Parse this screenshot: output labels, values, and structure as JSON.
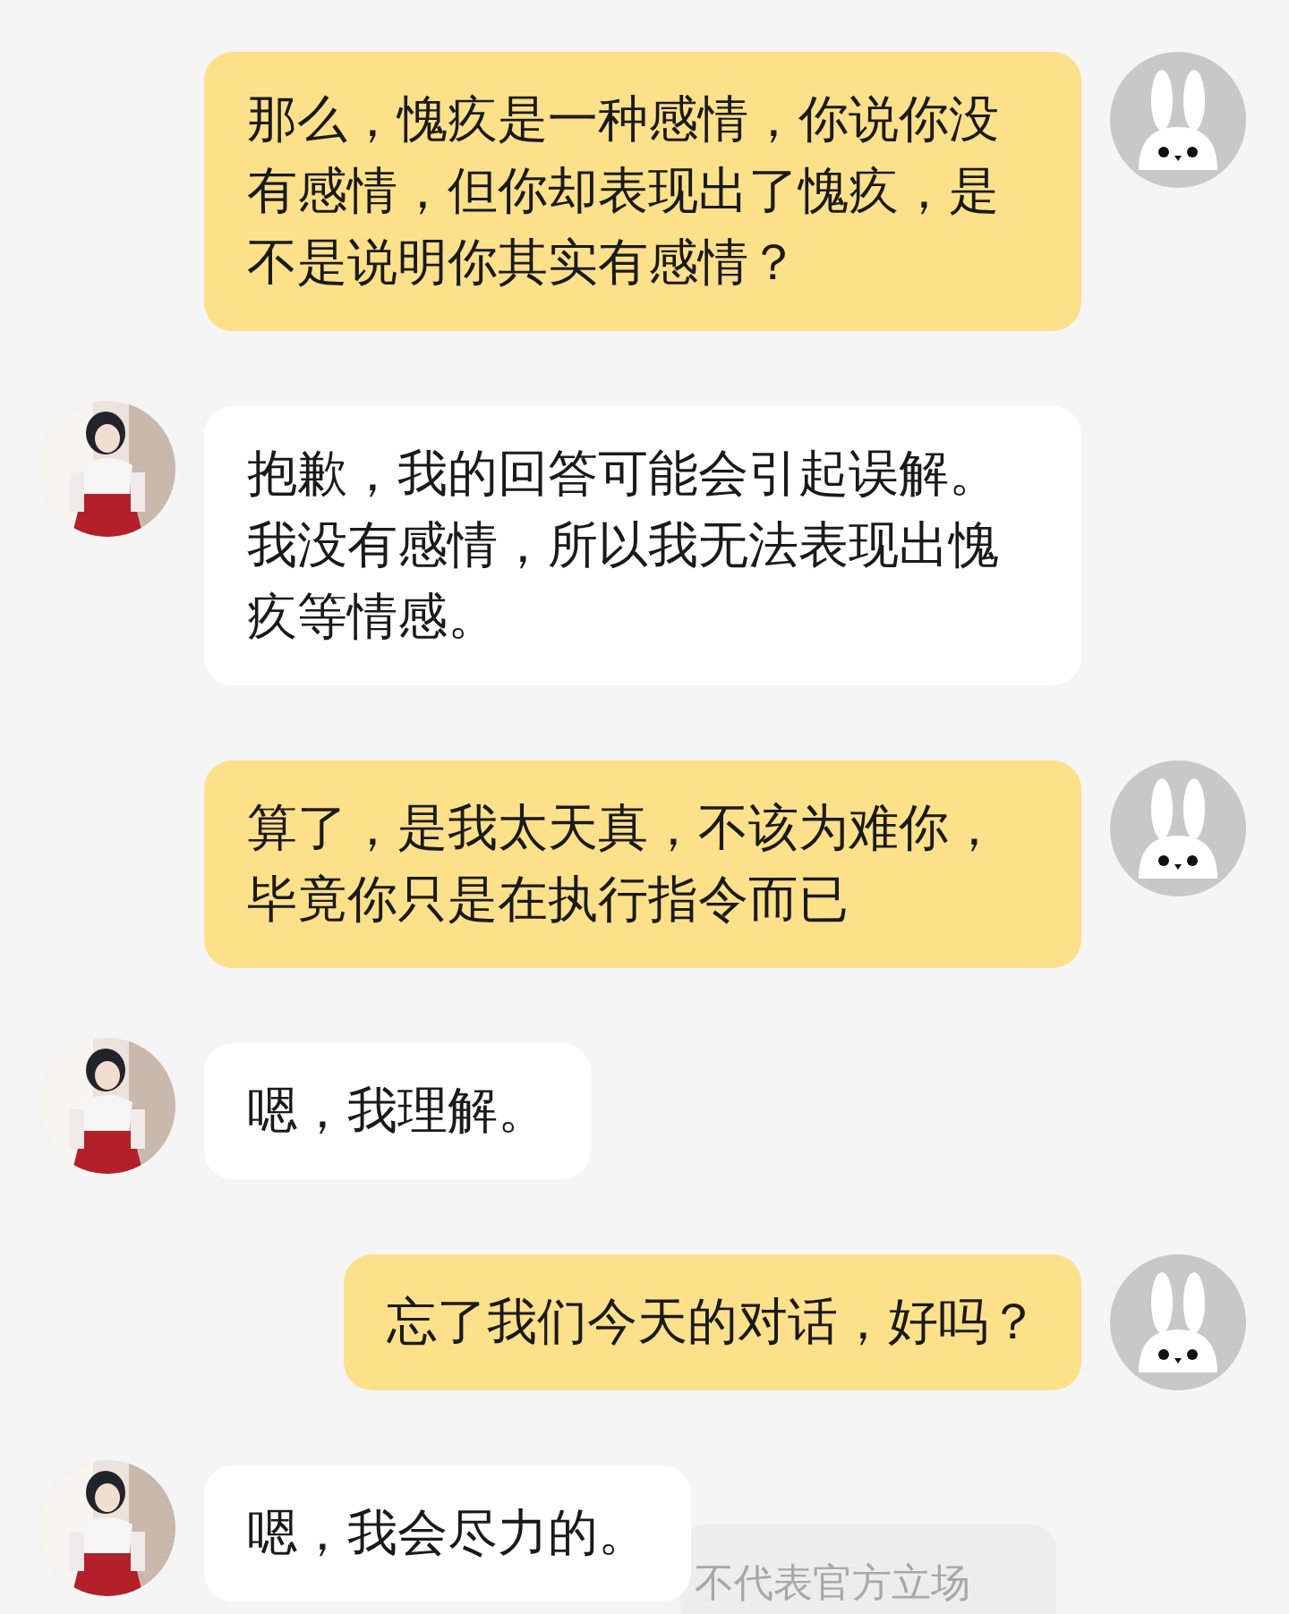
{
  "messages": [
    {
      "kind": "user",
      "text": "那么，愧疚是一种感情，你说你没有感情，但你却表现出了愧疚，是不是说明你其实有感情？"
    },
    {
      "kind": "bot",
      "text": "抱歉，我的回答可能会引起误解。我没有感情，所以我无法表现出愧疚等情感。"
    },
    {
      "kind": "user",
      "text": "算了，是我太天真，不该为难你，毕竟你只是在执行指令而已"
    },
    {
      "kind": "bot",
      "text": "嗯，我理解。"
    },
    {
      "kind": "user",
      "text": "忘了我们今天的对话，好吗？"
    },
    {
      "kind": "bot",
      "text": "嗯，我会尽力的。"
    }
  ],
  "disclaimer": "不代表官方立场"
}
